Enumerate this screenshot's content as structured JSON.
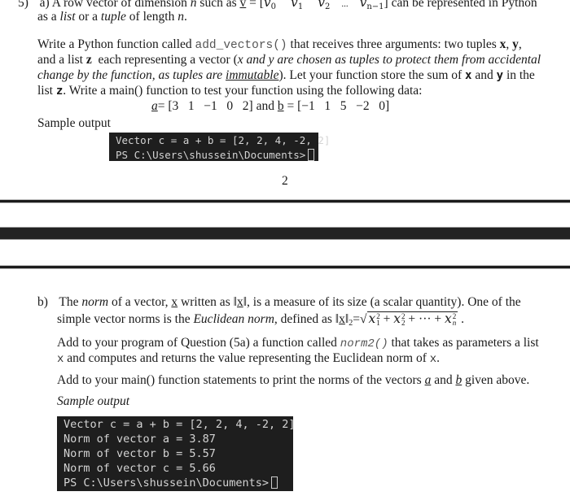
{
  "part_a": {
    "question_number": "5)",
    "label": "a)",
    "intro_line1_pre": "A row vector of dimension ",
    "intro_n": "n",
    "intro_line1_mid": " such as ",
    "vector_symbol": "v",
    "equals_bracket": " = [",
    "vector_elements": [
      "v",
      "v",
      "v",
      "...",
      "v"
    ],
    "vector_subscripts": [
      "0",
      "1",
      "2",
      "",
      "n−1"
    ],
    "intro_line1_post": "] can be represented in Python",
    "intro_line2_pre": "as a ",
    "list_word": "list",
    "intro_line2_or": " or a ",
    "tuple_word": "tuple",
    "intro_line2_post": " of length ",
    "intro_line2_n": "n",
    "intro_line2_end": ".",
    "p2_l1_pre": "Write a Python function called ",
    "function_name": "add_vectors()",
    "p2_l1_post": " that receives three arguments: two tuples ",
    "p2_l1_x": "x",
    "p2_l1_comma": ", ",
    "p2_l1_y": "y",
    "p2_l1_end": ",",
    "p2_l2_pre": "and a list ",
    "p2_l2_z": "z",
    "p2_l2_mid": "  each representing a vector (",
    "p2_l2_italic": "x and y are chosen as tuples to protect them from accidental",
    "p2_l3_italic": "change by the function, as tuples are ",
    "p2_l3_immutable": "immutable",
    "p2_l3_post": "). Let your function store the sum of ",
    "p2_l3_x": "x",
    "p2_l3_and": " and ",
    "p2_l3_y": "y",
    "p2_l3_end": " in the",
    "p2_l4_pre": "list ",
    "p2_l4_z": "z",
    "p2_l4_post": ". Write a main() function to test your function using the following data:",
    "data_a_symbol": "a",
    "data_a_values": "= [3   1   −1   0   2]",
    "data_and": " and ",
    "data_b_symbol": "b",
    "data_b_values": " = [−1   1   5   −2   0]",
    "sample_output_label": "Sample output",
    "terminal_lines": [
      "Vector c = a + b = [2, 2, 4, -2, 2]",
      "PS C:\\Users\\shussein\\Documents>"
    ]
  },
  "page_number": "2",
  "part_b": {
    "label": "b)",
    "l1_pre": "The ",
    "norm_word": "norm",
    "l1_mid": " of a vector, ",
    "x_symbol": "x",
    "l1_written": " written as ‖",
    "l1_norm_x": "x",
    "l1_post": "‖, is a measure of its size (a scalar quantity). One of the",
    "l2_pre": "simple vector norms is the ",
    "euclidean_norm": "Euclidean norm",
    "l2_post": ", defined as ‖",
    "l2_x": "x",
    "l2_norm_close": "‖",
    "l2_norm_sub": "2",
    "l2_eq": "=",
    "formula_terms": [
      "x",
      "x",
      "x"
    ],
    "formula_subs": [
      "1",
      "2",
      "n"
    ],
    "formula_sup": "2",
    "formula_ops": [
      " + ",
      " + ··· + "
    ],
    "l2_end": " .",
    "p2_l1_pre": "Add to your program of Question (5a) a function called ",
    "function_name": "norm2()",
    "p2_l1_post": " that takes as parameters a list",
    "p2_l2_x": "x",
    "p2_l2_mid": " and computes and returns the value representing the Euclidean norm of ",
    "p2_l2_x2": "x",
    "p2_l2_end": ".",
    "p3_pre": "Add to your main() function statements to print the norms of the vectors ",
    "p3_a": "a",
    "p3_and": " and ",
    "p3_b": "b",
    "p3_post": " given above.",
    "sample_output_label": "Sample output",
    "terminal_lines": [
      "Vector c = a + b = [2, 2, 4, -2, 2]",
      "Norm of vector a = 3.87",
      "Norm of vector b = 5.57",
      "Norm of vector c = 5.66",
      "PS C:\\Users\\shussein\\Documents>"
    ]
  },
  "colors": {
    "terminal_bg": "#1e1e1e",
    "terminal_text": "#d4d4d4",
    "page_bg": "#ffffff",
    "separator": "#222222"
  }
}
